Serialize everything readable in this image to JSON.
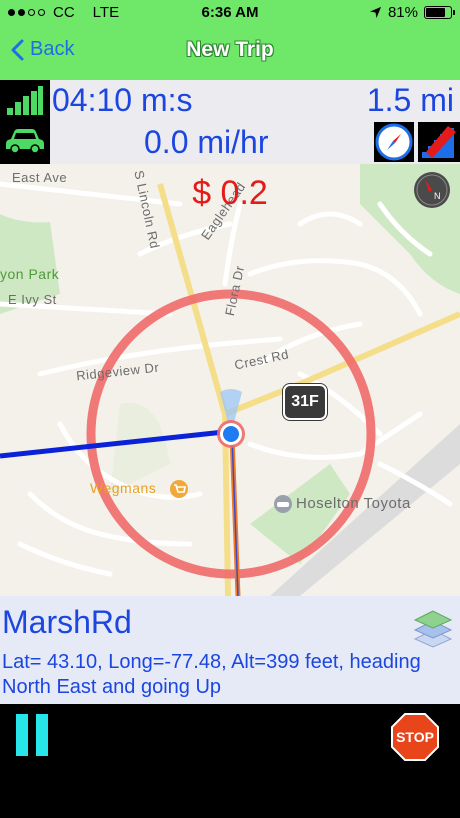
{
  "status_bar": {
    "carrier": "CC",
    "network": "LTE",
    "time": "6:36 AM",
    "battery": "81%"
  },
  "nav": {
    "back_label": "Back",
    "title": "New Trip"
  },
  "stats": {
    "elapsed": "04:10 m:s",
    "distance": "1.5 mi",
    "speed": "0.0 mi/hr"
  },
  "map": {
    "fare": "$ 0.2",
    "labels": {
      "east_ave": "East Ave",
      "lincoln_rd": "S Lincoln Rd",
      "eaglehead": "Eaglehead",
      "flora_dr": "Flora Dr",
      "park": "yon Park",
      "ivy_st": "E Ivy St",
      "ridgeview": "Ridgeview Dr",
      "crest_rd": "Crest Rd",
      "wegmans": "Wegmans",
      "dealer": "Hoselton Toyota",
      "marsh_rd": "Marsh Rd"
    },
    "route_shield": "31F"
  },
  "info": {
    "street": "MarshRd",
    "coords": "Lat= 43.10, Long=-77.48, Alt=399 feet, heading North East and going Up"
  },
  "toolbar": {
    "stop_label": "STOP"
  },
  "colors": {
    "header_green": "#6FE86A",
    "stat_blue": "#1B46E0",
    "fare_red": "#E51A1A",
    "pause_cyan": "#27E6EA",
    "stop_red": "#E8451A"
  },
  "icons": [
    "signal-bars-icon",
    "car-icon",
    "compass-icon",
    "stairs-icon",
    "map-compass-icon",
    "layers-icon",
    "pause-icon",
    "stop-sign-icon"
  ]
}
